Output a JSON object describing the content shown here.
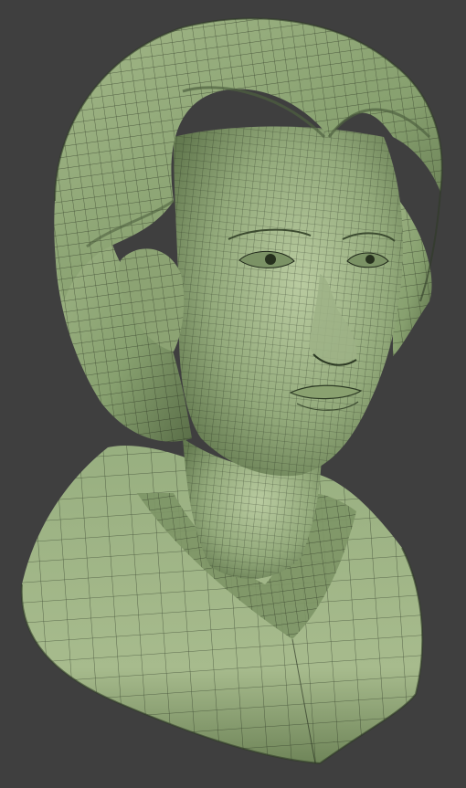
{
  "viewport": {
    "background": "#3f3f3f",
    "model": {
      "subject": "female-bust",
      "shading": "solid",
      "wireframe_overlay": true
    },
    "colors": {
      "base": "#8fa778",
      "highlight": "#b7c99d",
      "shadow": "#4a5a3a",
      "wire": "#1e2618"
    }
  }
}
